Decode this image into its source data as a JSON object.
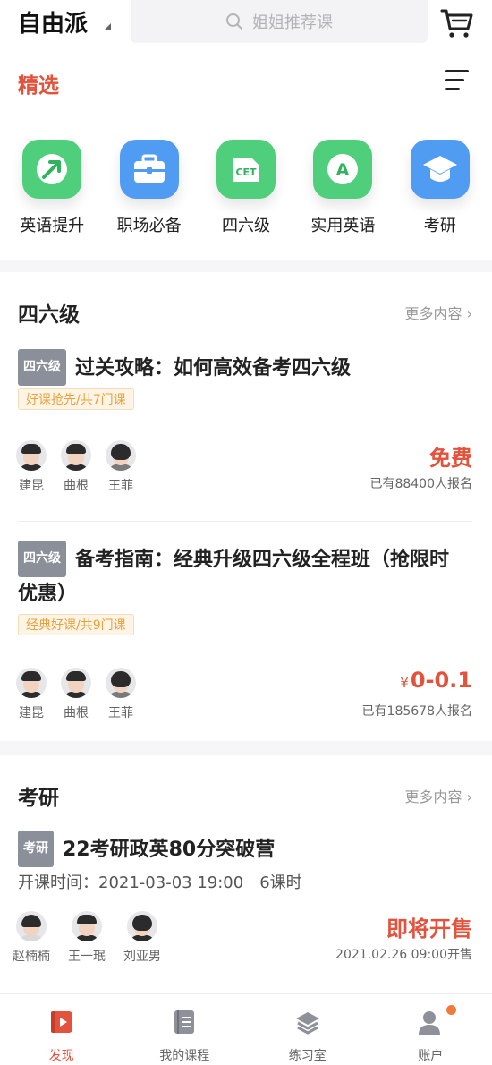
{
  "header": {
    "brand": "自由派",
    "search_placeholder": "姐姐推荐课",
    "selected_tab": "精选"
  },
  "categories": [
    {
      "label": "英语提升",
      "icon": "arrow-up-icon",
      "color": "#4fcf7c"
    },
    {
      "label": "职场必备",
      "icon": "briefcase-icon",
      "color": "#4f9cf2"
    },
    {
      "label": "四六级",
      "icon": "cet-icon",
      "color": "#4fcf7c"
    },
    {
      "label": "实用英语",
      "icon": "letter-a-icon",
      "color": "#4fcf7c"
    },
    {
      "label": "考研",
      "icon": "graduation-cap-icon",
      "color": "#4f9cf2"
    }
  ],
  "sections": [
    {
      "title": "四六级",
      "more": "更多内容",
      "courses": [
        {
          "tag": "四六级",
          "title": "过关攻略：如何高效备考四六级",
          "promo": "好课抢先/共7门课",
          "teachers": [
            "建昆",
            "曲根",
            "王菲"
          ],
          "price": "免费",
          "enrolled": "已有88400人报名"
        },
        {
          "tag": "四六级",
          "title": "备考指南：经典升级四六级全程班（抢限时优惠）",
          "promo": "经典好课/共9门课",
          "teachers": [
            "建昆",
            "曲根",
            "王菲"
          ],
          "price_symbol": "¥",
          "price": "0-0.1",
          "enrolled": "已有185678人报名"
        }
      ]
    },
    {
      "title": "考研",
      "more": "更多内容",
      "courses": [
        {
          "tag": "考研",
          "title": "22考研政英80分突破营",
          "start_time": "开课时间：2021-03-03 19:00",
          "lessons": "6课时",
          "teachers": [
            "赵楠楠",
            "王一珉",
            "刘亚男"
          ],
          "price": "即将开售",
          "sale_time": "2021.02.26 09:00开售"
        }
      ]
    }
  ],
  "tabbar": {
    "items": [
      {
        "label": "发现",
        "icon": "play-book-icon",
        "active": true
      },
      {
        "label": "我的课程",
        "icon": "notebook-icon",
        "active": false
      },
      {
        "label": "练习室",
        "icon": "layers-icon",
        "active": false
      },
      {
        "label": "账户",
        "icon": "user-icon",
        "active": false
      }
    ]
  },
  "colors": {
    "accent": "#e3523d",
    "promo_text": "#e8a13b",
    "tag_bg": "#8a8f99"
  }
}
